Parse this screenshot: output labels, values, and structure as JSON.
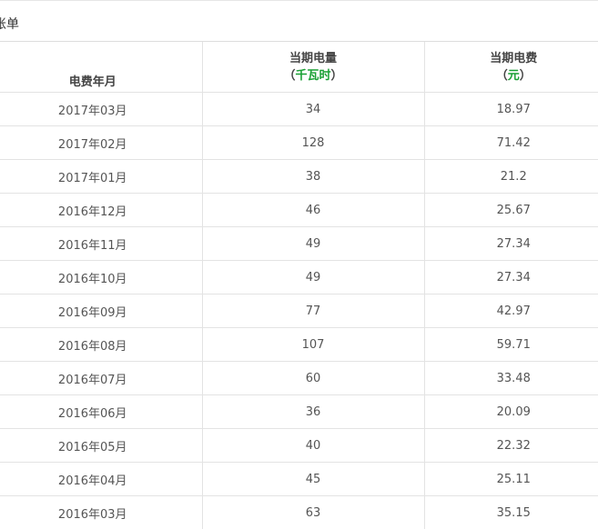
{
  "section": {
    "title": "账单"
  },
  "table": {
    "headers": {
      "month": "电费年月",
      "usage": "当期电量",
      "usage_unit": "千瓦时",
      "fee": "当期电费",
      "fee_unit": "元",
      "paren_open": "（",
      "paren_close": "）"
    },
    "rows": [
      {
        "month": "2017年03月",
        "usage": "34",
        "fee": "18.97"
      },
      {
        "month": "2017年02月",
        "usage": "128",
        "fee": "71.42"
      },
      {
        "month": "2017年01月",
        "usage": "38",
        "fee": "21.2"
      },
      {
        "month": "2016年12月",
        "usage": "46",
        "fee": "25.67"
      },
      {
        "month": "2016年11月",
        "usage": "49",
        "fee": "27.34"
      },
      {
        "month": "2016年10月",
        "usage": "49",
        "fee": "27.34"
      },
      {
        "month": "2016年09月",
        "usage": "77",
        "fee": "42.97"
      },
      {
        "month": "2016年08月",
        "usage": "107",
        "fee": "59.71"
      },
      {
        "month": "2016年07月",
        "usage": "60",
        "fee": "33.48"
      },
      {
        "month": "2016年06月",
        "usage": "36",
        "fee": "20.09"
      },
      {
        "month": "2016年05月",
        "usage": "40",
        "fee": "22.32"
      },
      {
        "month": "2016年04月",
        "usage": "45",
        "fee": "25.11"
      },
      {
        "month": "2016年03月",
        "usage": "63",
        "fee": "35.15"
      }
    ]
  },
  "colors": {
    "unit_green": "#1aa034",
    "border": "#e3e3e3",
    "text": "#555555"
  }
}
